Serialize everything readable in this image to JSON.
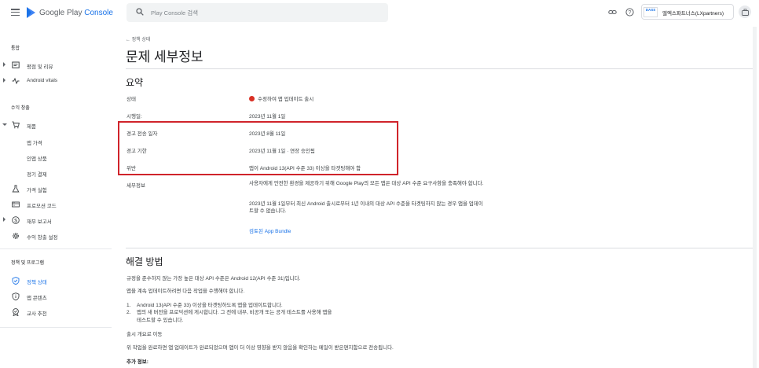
{
  "header": {
    "logo_text_a": "Google Play",
    "logo_text_b": "Console",
    "search_placeholder": "Play Console 검색",
    "account_logo": "DASS",
    "account_name": "엘엑스파트너스(LXpartners)",
    "icons": [
      "menu-icon",
      "play-console-logo-icon",
      "search-icon",
      "link-icon",
      "help-icon",
      "account-icon"
    ]
  },
  "sidebar": {
    "sections": [
      {
        "label": "통합"
      },
      {
        "label": "수익 창출"
      },
      {
        "label": "정책 및 프로그램"
      }
    ],
    "items": [
      {
        "label": "평점 및 리뷰",
        "icon": "ratings-icon",
        "caret": "right"
      },
      {
        "label": "Android vitals",
        "icon": "vitals-icon",
        "caret": "right"
      },
      {
        "label": "제품",
        "icon": "cart-icon",
        "caret": "down"
      },
      {
        "label": "앱 가격"
      },
      {
        "label": "인앱 상품"
      },
      {
        "label": "정기 결제"
      },
      {
        "label": "가격 실험",
        "icon": "flask-icon"
      },
      {
        "label": "프로모션 코드",
        "icon": "promo-icon"
      },
      {
        "label": "재무 보고서",
        "icon": "dollar-icon",
        "caret": "right"
      },
      {
        "label": "수익 창출 설정",
        "icon": "gear-icon"
      },
      {
        "label": "정책 상태",
        "icon": "shield-check-icon",
        "active": true
      },
      {
        "label": "앱 콘텐츠",
        "icon": "shield-info-icon"
      },
      {
        "label": "교사 추천",
        "icon": "badge-icon"
      }
    ]
  },
  "main": {
    "back_label": "← 정책 상태",
    "title": "문제 세부정보",
    "summary": {
      "heading": "요약",
      "rows": [
        {
          "key": "상태",
          "value": "수정하여 앱 업데이트 출시",
          "status_color": "#d93025"
        },
        {
          "key": "시행일:",
          "value": "2023년 11월 1일"
        },
        {
          "key": "경고 전송 일자",
          "value": "2023년 8월 11일"
        },
        {
          "key": "경고 기한",
          "value": "2023년 11월 1일 · 연장 승인됨"
        },
        {
          "key": "위반",
          "value": "앱이 Android 13(API 수준 33) 이상을 타겟팅해야 함"
        },
        {
          "key": "세부정보",
          "value": "사용자에게 안전한 환경을 제공하기 위해 Google Play의 모든 앱은 대상 API 수준 요구사항을 충족해야 합니다."
        }
      ],
      "detail_para2": "2023년 11월 1일부터 최신 Android 출시로부터 1년 이내의 대상 API 수준을 타겟팅하지 않는 경우 앱을 업데이트할 수 없습니다.",
      "review_link": "검토된 App Bundle"
    },
    "resolve": {
      "heading": "해결 방법",
      "para1": "규정을 준수하지 않는 가장 높은 대상 API 수준은 Android 12(API 수준 31)입니다.",
      "para2": "앱을 계속 업데이트하려면 다음 작업을 수행해야 합니다.",
      "steps": [
        {
          "num": "1.",
          "text": "Android 13(API 수준 33) 이상을 타겟팅하도록 앱을 업데이트합니다."
        },
        {
          "num": "2.",
          "text": "앱의 새 버전을 프로덕션에 게시합니다. 그 전에 내부, 비공개 또는 공개 테스트를 사용해 앱을",
          "cont": "테스트할 수 있습니다."
        }
      ],
      "overview_link": "출시 개요로 이동",
      "para3": "위 작업을 완료하면 앱 업데이트가 완료되었으며 앱이 더 이상 영향을 받지 않음을 확인하는 메일이 받은편지함으로 전송됩니다.",
      "more_info": "추가 정보:"
    }
  }
}
